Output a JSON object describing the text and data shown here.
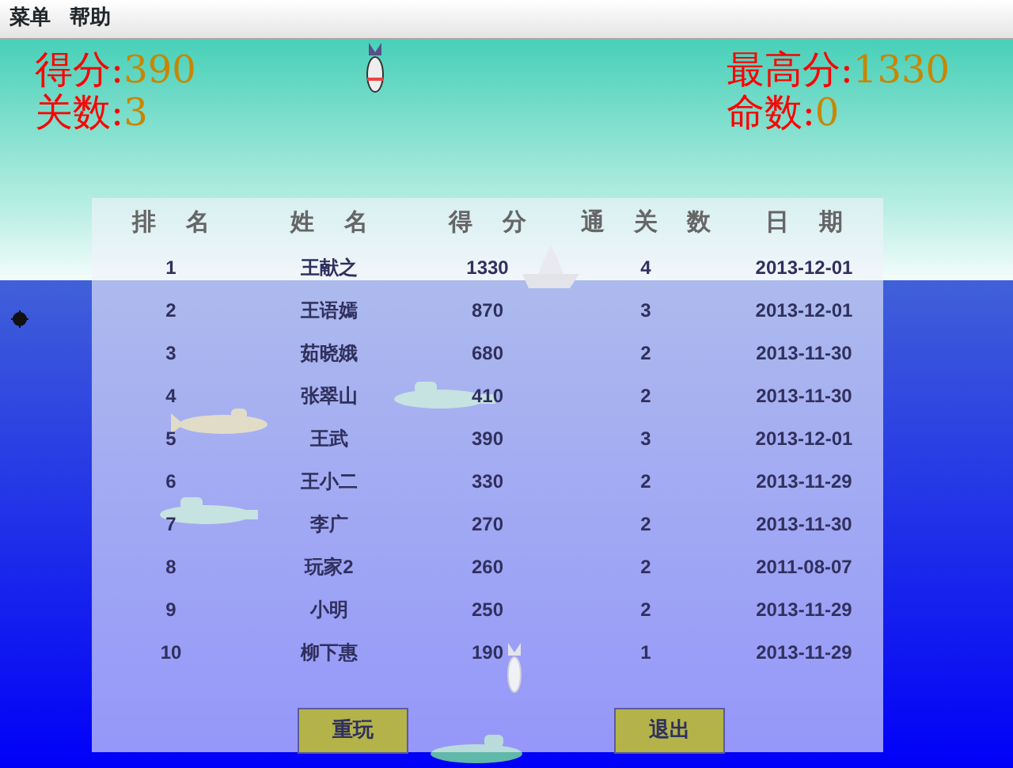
{
  "menu": [
    "菜单",
    "帮助"
  ],
  "hud": {
    "left": [
      {
        "label": "得分:",
        "value": "390"
      },
      {
        "label": "关数:",
        "value": "3"
      }
    ],
    "right": [
      {
        "label": "最高分:",
        "value": "1330"
      },
      {
        "label": "命数:",
        "value": "0"
      }
    ]
  },
  "ranking": {
    "columns": [
      "排 名",
      "姓 名",
      "得 分",
      "通 关 数",
      "日 期"
    ],
    "rows": [
      [
        "1",
        "王献之",
        "1330",
        "4",
        "2013-12-01"
      ],
      [
        "2",
        "王语嫣",
        "870",
        "3",
        "2013-12-01"
      ],
      [
        "3",
        "茹晓娥",
        "680",
        "2",
        "2013-11-30"
      ],
      [
        "4",
        "张翠山",
        "410",
        "2",
        "2013-11-30"
      ],
      [
        "5",
        "王武",
        "390",
        "3",
        "2013-12-01"
      ],
      [
        "6",
        "王小二",
        "330",
        "2",
        "2013-11-29"
      ],
      [
        "7",
        "李广",
        "270",
        "2",
        "2013-11-30"
      ],
      [
        "8",
        "玩家2",
        "260",
        "2",
        "2011-08-07"
      ],
      [
        "9",
        "小明",
        "250",
        "2",
        "2013-11-29"
      ],
      [
        "10",
        "柳下惠",
        "190",
        "1",
        "2013-11-29"
      ]
    ]
  },
  "buttons": [
    "重玩",
    "退出"
  ]
}
